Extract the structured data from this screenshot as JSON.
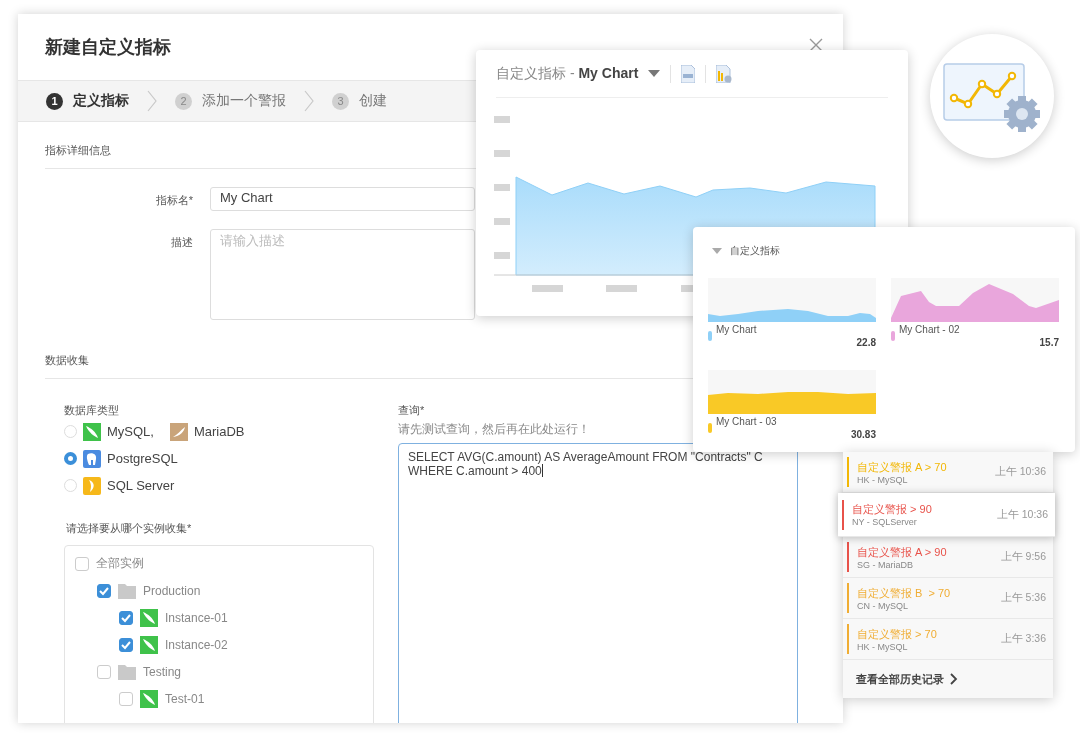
{
  "dialog": {
    "title": "新建自定义指标",
    "steps": [
      {
        "number": "1",
        "label": "定义指标",
        "selected": true
      },
      {
        "number": "2",
        "label": "添加一个警报",
        "selected": false
      },
      {
        "number": "3",
        "label": "创建",
        "selected": false
      }
    ],
    "details_section": "指标详细信息",
    "name_field": {
      "label": "指标名*",
      "value": "My Chart"
    },
    "description_field": {
      "label": "描述",
      "placeholder": "请输入描述"
    },
    "collection_section": "数据收集",
    "db_type": {
      "label": "数据库类型",
      "options": [
        {
          "selected": false,
          "products": [
            {
              "kind": "mysql",
              "label": "MySQL,"
            },
            {
              "kind": "mariadb",
              "label": "MariaDB"
            }
          ]
        },
        {
          "selected": true,
          "products": [
            {
              "kind": "postgresql",
              "label": "PostgreSQL"
            }
          ]
        },
        {
          "selected": false,
          "products": [
            {
              "kind": "sqlserver",
              "label": "SQL Server"
            }
          ]
        }
      ]
    },
    "instances": {
      "label": "请选择要从哪个实例收集*",
      "tree": [
        {
          "label": "全部实例",
          "checked": false,
          "children": [
            {
              "kind": "folder",
              "label": "Production",
              "checked": true,
              "children": [
                {
                  "kind": "instance",
                  "label": "Instance-01",
                  "checked": true
                },
                {
                  "kind": "instance",
                  "label": "Instance-02",
                  "checked": true
                }
              ]
            },
            {
              "kind": "folder",
              "label": "Testing",
              "checked": false,
              "children": [
                {
                  "kind": "instance",
                  "label": "Test-01",
                  "checked": false
                }
              ]
            }
          ]
        }
      ]
    },
    "query": {
      "label": "查询*",
      "hint": "请先测试查询，然后再在此处运行！",
      "value": "SELECT AVG(C.amount) AS AverageAmount FROM \"Contracts\" C\nWHERE C.amount > 400"
    }
  },
  "chart_panel": {
    "title": "自定义指标 - **My Chart**"
  },
  "metrics_panel": {
    "title": "自定义指标",
    "charts": [
      {
        "name": "My Chart",
        "value": "22.8",
        "color": "#8fd0f7"
      },
      {
        "name": "My Chart - 02",
        "value": "15.7",
        "color": "#e9a6dc"
      },
      {
        "name": "My Chart - 03",
        "value": "30.83",
        "color": "#f9c926"
      }
    ]
  },
  "alerts": {
    "items": [
      {
        "title": "自定义警报 A > 70",
        "source": "HK - MySQL",
        "time": "上午 10:36",
        "color": "#f2b705",
        "selected": false
      },
      {
        "title": "自定义警报 > 90",
        "source": "NY - SQLServer",
        "time": "上午 10:36",
        "color": "#e8524a",
        "selected": true
      },
      {
        "title": "自定义警报 A > 90",
        "source": "SG - MariaDB",
        "time": "上午 9:56",
        "color": "#e8524a",
        "selected": false
      },
      {
        "title": "自定义警报 B  > 70",
        "source": "CN - MySQL",
        "time": "上午 5:36",
        "color": "#f0ad33",
        "selected": false
      },
      {
        "title": "自定义警报 > 70",
        "source": "HK - MySQL",
        "time": "上午 3:36",
        "color": "#f0ad33",
        "selected": false
      }
    ],
    "footer": "查看全部历史记录"
  }
}
